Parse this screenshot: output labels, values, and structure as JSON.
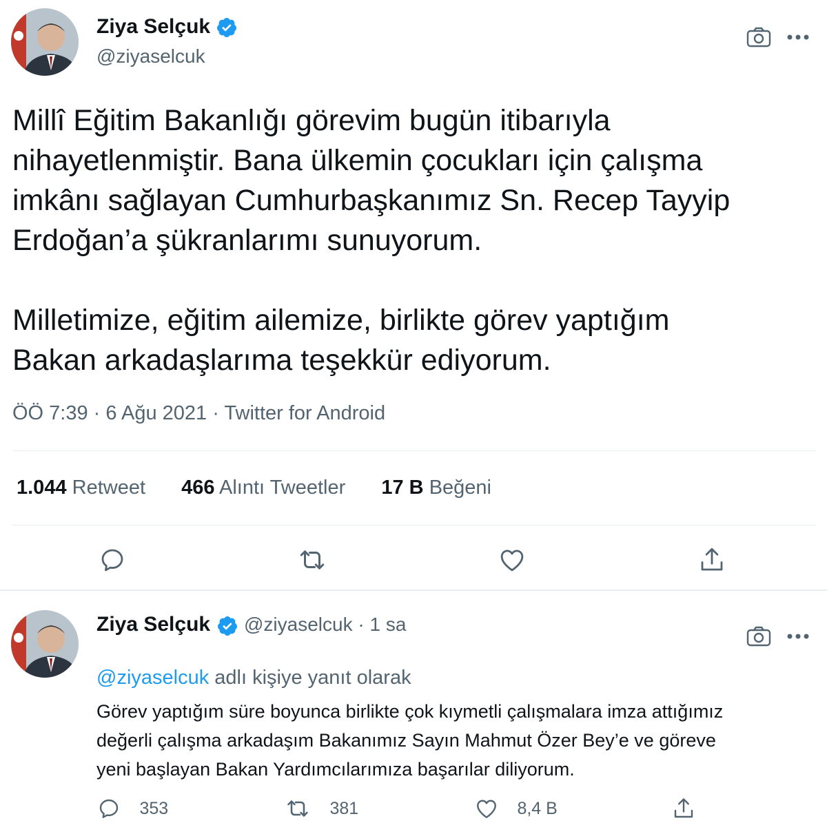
{
  "main_tweet": {
    "author_name": "Ziya Selçuk",
    "author_handle": "@ziyaselcuk",
    "text_p1_lines": [
      "Millî Eğitim Bakanlığı görevim bugün itibarıyla",
      "nihayetlenmiştir. Bana ülkemin çocukları için çalışma",
      "imkânı sağlayan Cumhurbaşkanımız Sn. Recep Tayyip",
      "Erdoğan’a şükranlarımı sunuyorum."
    ],
    "text_p2_lines": [
      "Milletimize, eğitim ailemize, birlikte görev yaptığım",
      "Bakan arkadaşlarıma teşekkür ediyorum."
    ],
    "meta": "ÖÖ 7:39 · 6 Ağu 2021 · Twitter for Android",
    "stats": {
      "retweets": "1.044",
      "retweets_label": "Retweet",
      "quotes": "466",
      "quotes_label": "Alıntı Tweetler",
      "likes": "17 B",
      "likes_label": "Beğeni"
    }
  },
  "reply_tweet": {
    "author_name": "Ziya Selçuk",
    "handle_time": "@ziyaselcuk · 1 sa",
    "reply_to_handle": "@ziyaselcuk",
    "reply_to_suffix": "adlı kişiye yanıt olarak",
    "text_lines": [
      "Görev yaptığım süre boyunca birlikte çok kıymetli çalışmalara imza attığımız",
      "değerli çalışma arkadaşım Bakanımız Sayın Mahmut Özer Bey’e ve göreve",
      "yeni başlayan Bakan Yardımcılarımıza  başarılar diliyorum."
    ],
    "counts": {
      "replies": "353",
      "retweets": "381",
      "likes": "8,4 B"
    }
  },
  "colors": {
    "accent": "#1d9bf0",
    "text": "#0f1419",
    "muted": "#536471"
  },
  "icons": [
    "verified-badge-icon",
    "camera-icon",
    "more-icon",
    "reply-icon",
    "retweet-icon",
    "like-icon",
    "share-icon"
  ]
}
